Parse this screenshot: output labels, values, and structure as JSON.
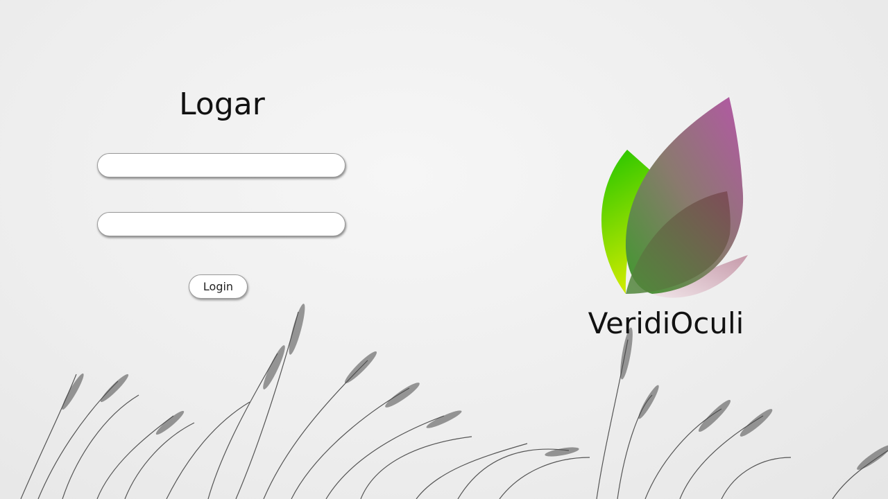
{
  "login": {
    "title": "Logar",
    "username_value": "",
    "password_value": "",
    "button_label": "Login"
  },
  "brand": {
    "name": "VeridiOculi",
    "logo_icon": "leaf-logo-icon",
    "colors": {
      "green": "#22c400",
      "lime": "#c9ea00",
      "magenta": "#b457a6",
      "wine": "#7a4652",
      "olive": "#6c8a52"
    }
  },
  "background": {
    "image": "grass-silhouette-background"
  }
}
